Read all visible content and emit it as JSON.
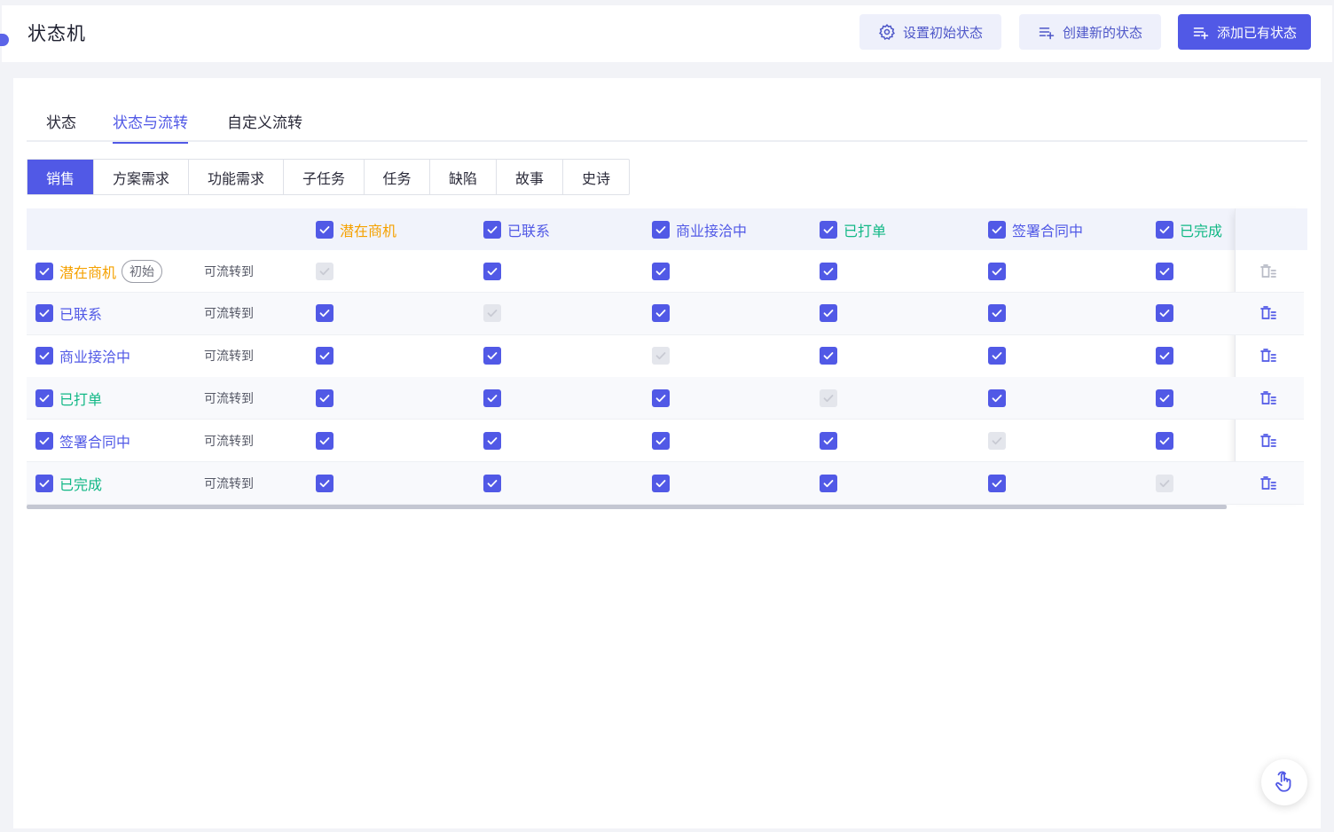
{
  "header": {
    "title": "状态机",
    "buttons": {
      "set_initial": "设置初始状态",
      "create_new": "创建新的状态",
      "add_existing": "添加已有状态"
    }
  },
  "tabs": [
    "状态",
    "状态与流转",
    "自定义流转"
  ],
  "active_tab": "状态与流转",
  "types": [
    "销售",
    "方案需求",
    "功能需求",
    "子任务",
    "任务",
    "缺陷",
    "故事",
    "史诗"
  ],
  "active_type": "销售",
  "states": [
    {
      "name": "潜在商机",
      "color": "#f5a100"
    },
    {
      "name": "已联系",
      "color": "#5159e6"
    },
    {
      "name": "商业接洽中",
      "color": "#5159e6"
    },
    {
      "name": "已打单",
      "color": "#12b886"
    },
    {
      "name": "签署合同中",
      "color": "#5159e6"
    },
    {
      "name": "已完成",
      "color": "#12b886"
    }
  ],
  "initial_badge": "初始",
  "flow_label": "可流转到",
  "colors": {
    "accent": "#5159e6",
    "orange": "#f5a100",
    "green": "#12b886"
  }
}
